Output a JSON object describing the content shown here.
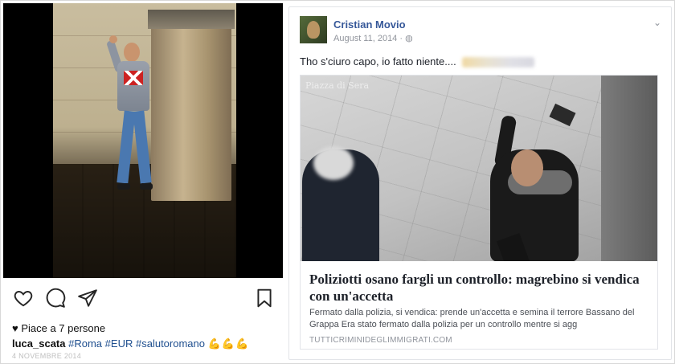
{
  "instagram": {
    "likes": "♥ Piace a 7 persone",
    "caption": {
      "username": "luca_scata",
      "hashtags": [
        "#Roma",
        "#EUR",
        "#salutoromano"
      ],
      "emoji": "💪💪💪"
    },
    "date": "4 NOVEMBRE 2014",
    "icons": [
      "heart-icon",
      "comment-icon",
      "share-icon",
      "bookmark-icon"
    ]
  },
  "facebook": {
    "author": "Cristian Movio",
    "date": "August 11, 2014",
    "privacy_icon": "globe-icon",
    "status": "Tho s'ciuro capo, io fatto niente....",
    "link": {
      "watermark": "Piazza di Sera",
      "headline": "Poliziotti osano fargli un controllo: magrebino si vendica con un'accetta",
      "description": "Fermato dalla polizia, si vendica: prende un'accetta e semina il terrore Bassano del Grappa Era stato fermato dalla polizia per un controllo mentre si agg",
      "domain": "TUTTICRIMINIDEGLIMMIGRATI.COM"
    }
  },
  "colors": {
    "facebook_name": "#365899",
    "instagram_tag": "#1f4f8f",
    "muted": "#90949c"
  }
}
